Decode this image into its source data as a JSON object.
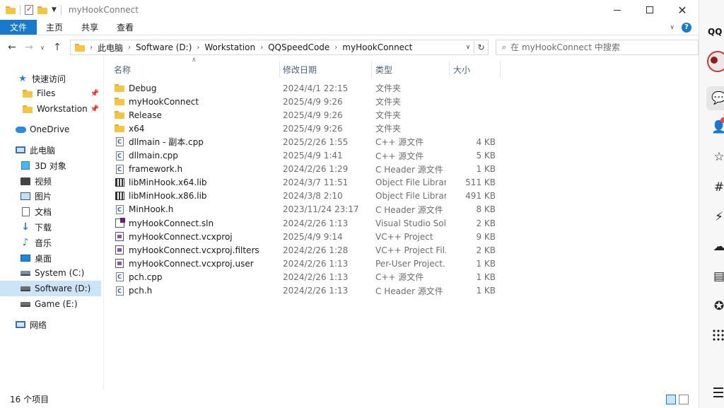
{
  "window": {
    "title": "myHookConnect",
    "minimize_label": "—",
    "maximize_label": "□",
    "close_label": "✕"
  },
  "ribbon": {
    "tabs": [
      "文件",
      "主页",
      "共享",
      "查看"
    ]
  },
  "address_bar": {
    "crumbs": [
      "此电脑",
      "Software (D:)",
      "Workstation",
      "QQSpeedCode",
      "myHookConnect"
    ]
  },
  "search": {
    "placeholder": "在 myHookConnect 中搜索"
  },
  "nav_pane": {
    "items": [
      {
        "label": "快速访问",
        "icon": "star-icon"
      },
      {
        "label": "Files",
        "icon": "folder-icon",
        "pinned": true
      },
      {
        "label": "Workstation",
        "icon": "folder-icon",
        "pinned": true
      },
      {
        "label": "OneDrive",
        "icon": "cloud-icon"
      },
      {
        "label": "此电脑",
        "icon": "computer-icon"
      },
      {
        "label": "3D 对象",
        "icon": "cube-icon"
      },
      {
        "label": "视频",
        "icon": "video-icon"
      },
      {
        "label": "图片",
        "icon": "picture-icon"
      },
      {
        "label": "文档",
        "icon": "document-icon"
      },
      {
        "label": "下载",
        "icon": "download-icon"
      },
      {
        "label": "音乐",
        "icon": "music-icon"
      },
      {
        "label": "桌面",
        "icon": "desktop-icon"
      },
      {
        "label": "System (C:)",
        "icon": "drive-icon"
      },
      {
        "label": "Software (D:)",
        "icon": "drive-icon",
        "selected": true
      },
      {
        "label": "Game (E:)",
        "icon": "drive-icon"
      },
      {
        "label": "网络",
        "icon": "network-icon"
      }
    ]
  },
  "file_list": {
    "columns": [
      "名称",
      "修改日期",
      "类型",
      "大小"
    ],
    "rows": [
      {
        "name": "Debug",
        "date": "2024/4/1 22:15",
        "type": "文件夹",
        "size": "",
        "icon": "folder-icon"
      },
      {
        "name": "myHookConnect",
        "date": "2025/4/9 9:26",
        "type": "文件夹",
        "size": "",
        "icon": "folder-icon"
      },
      {
        "name": "Release",
        "date": "2025/4/9 9:26",
        "type": "文件夹",
        "size": "",
        "icon": "folder-icon"
      },
      {
        "name": "x64",
        "date": "2025/4/9 9:26",
        "type": "文件夹",
        "size": "",
        "icon": "folder-icon"
      },
      {
        "name": "dllmain - 副本.cpp",
        "date": "2025/2/26 1:55",
        "type": "C++ 源文件",
        "size": "4 KB",
        "icon": "cpp-file-icon"
      },
      {
        "name": "dllmain.cpp",
        "date": "2025/4/9 1:41",
        "type": "C++ 源文件",
        "size": "5 KB",
        "icon": "cpp-file-icon"
      },
      {
        "name": "framework.h",
        "date": "2024/2/26 1:29",
        "type": "C Header 源文件",
        "size": "1 KB",
        "icon": "header-file-icon"
      },
      {
        "name": "libMinHook.x64.lib",
        "date": "2024/3/7 11:51",
        "type": "Object File Library",
        "size": "511 KB",
        "icon": "library-file-icon"
      },
      {
        "name": "libMinHook.x86.lib",
        "date": "2024/3/8 2:10",
        "type": "Object File Library",
        "size": "491 KB",
        "icon": "library-file-icon"
      },
      {
        "name": "MinHook.h",
        "date": "2023/11/24 23:17",
        "type": "C Header 源文件",
        "size": "8 KB",
        "icon": "header-file-icon"
      },
      {
        "name": "myHookConnect.sln",
        "date": "2024/2/26 1:13",
        "type": "Visual Studio Sol...",
        "size": "2 KB",
        "icon": "solution-file-icon"
      },
      {
        "name": "myHookConnect.vcxproj",
        "date": "2025/4/9 9:14",
        "type": "VC++ Project",
        "size": "9 KB",
        "icon": "project-file-icon"
      },
      {
        "name": "myHookConnect.vcxproj.filters",
        "date": "2024/2/26 1:28",
        "type": "VC++ Project Fil...",
        "size": "2 KB",
        "icon": "project-file-icon"
      },
      {
        "name": "myHookConnect.vcxproj.user",
        "date": "2024/2/26 1:13",
        "type": "Per-User Project...",
        "size": "1 KB",
        "icon": "project-file-icon"
      },
      {
        "name": "pch.cpp",
        "date": "2024/2/26 1:13",
        "type": "C++ 源文件",
        "size": "1 KB",
        "icon": "cpp-file-icon"
      },
      {
        "name": "pch.h",
        "date": "2024/2/26 1:13",
        "type": "C Header 源文件",
        "size": "1 KB",
        "icon": "header-file-icon"
      }
    ]
  },
  "status": {
    "item_count": "16 个项目"
  },
  "qq_panel": {
    "logo": "QQ"
  },
  "colors": {
    "accent": "#1979ca",
    "selection": "#cce4f7",
    "folder": "#f4c542",
    "qq_blue": "#0a99ff",
    "badge_red": "#f5443b"
  }
}
